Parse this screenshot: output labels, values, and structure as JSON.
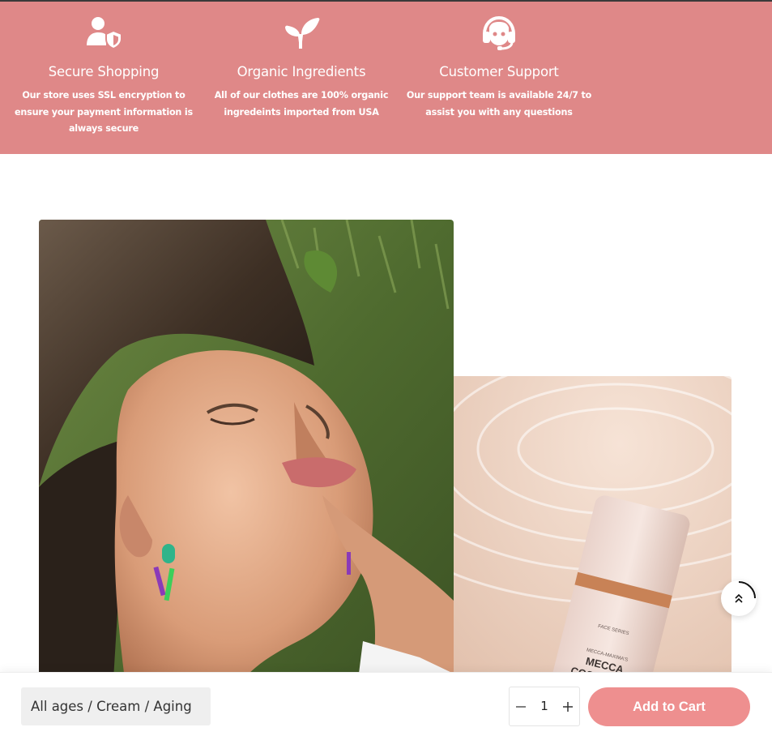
{
  "features": [
    {
      "icon": "user-shield-icon",
      "title": "Secure Shopping",
      "description": "Our store uses SSL encryption to ensure your payment information is always secure"
    },
    {
      "icon": "sprout-icon",
      "title": "Organic Ingredients",
      "description": "All of our clothes are 100% organic ingredeints imported from USA"
    },
    {
      "icon": "headset-icon",
      "title": "Customer Support",
      "description": "Our support team is available 24/7 to assist you with any questions"
    }
  ],
  "product_label": {
    "line1": "FACE SERIES",
    "line2": "MECCA-MAXIMA'S",
    "line3": "MECCA",
    "line4": "COSMETICA"
  },
  "sticky_bar": {
    "variant": "All ages / Cream / Aging",
    "quantity": "1",
    "add_to_cart_label": "Add to Cart"
  },
  "colors": {
    "feature_band": "#df8888",
    "accent_button": "#ee8f8f"
  }
}
